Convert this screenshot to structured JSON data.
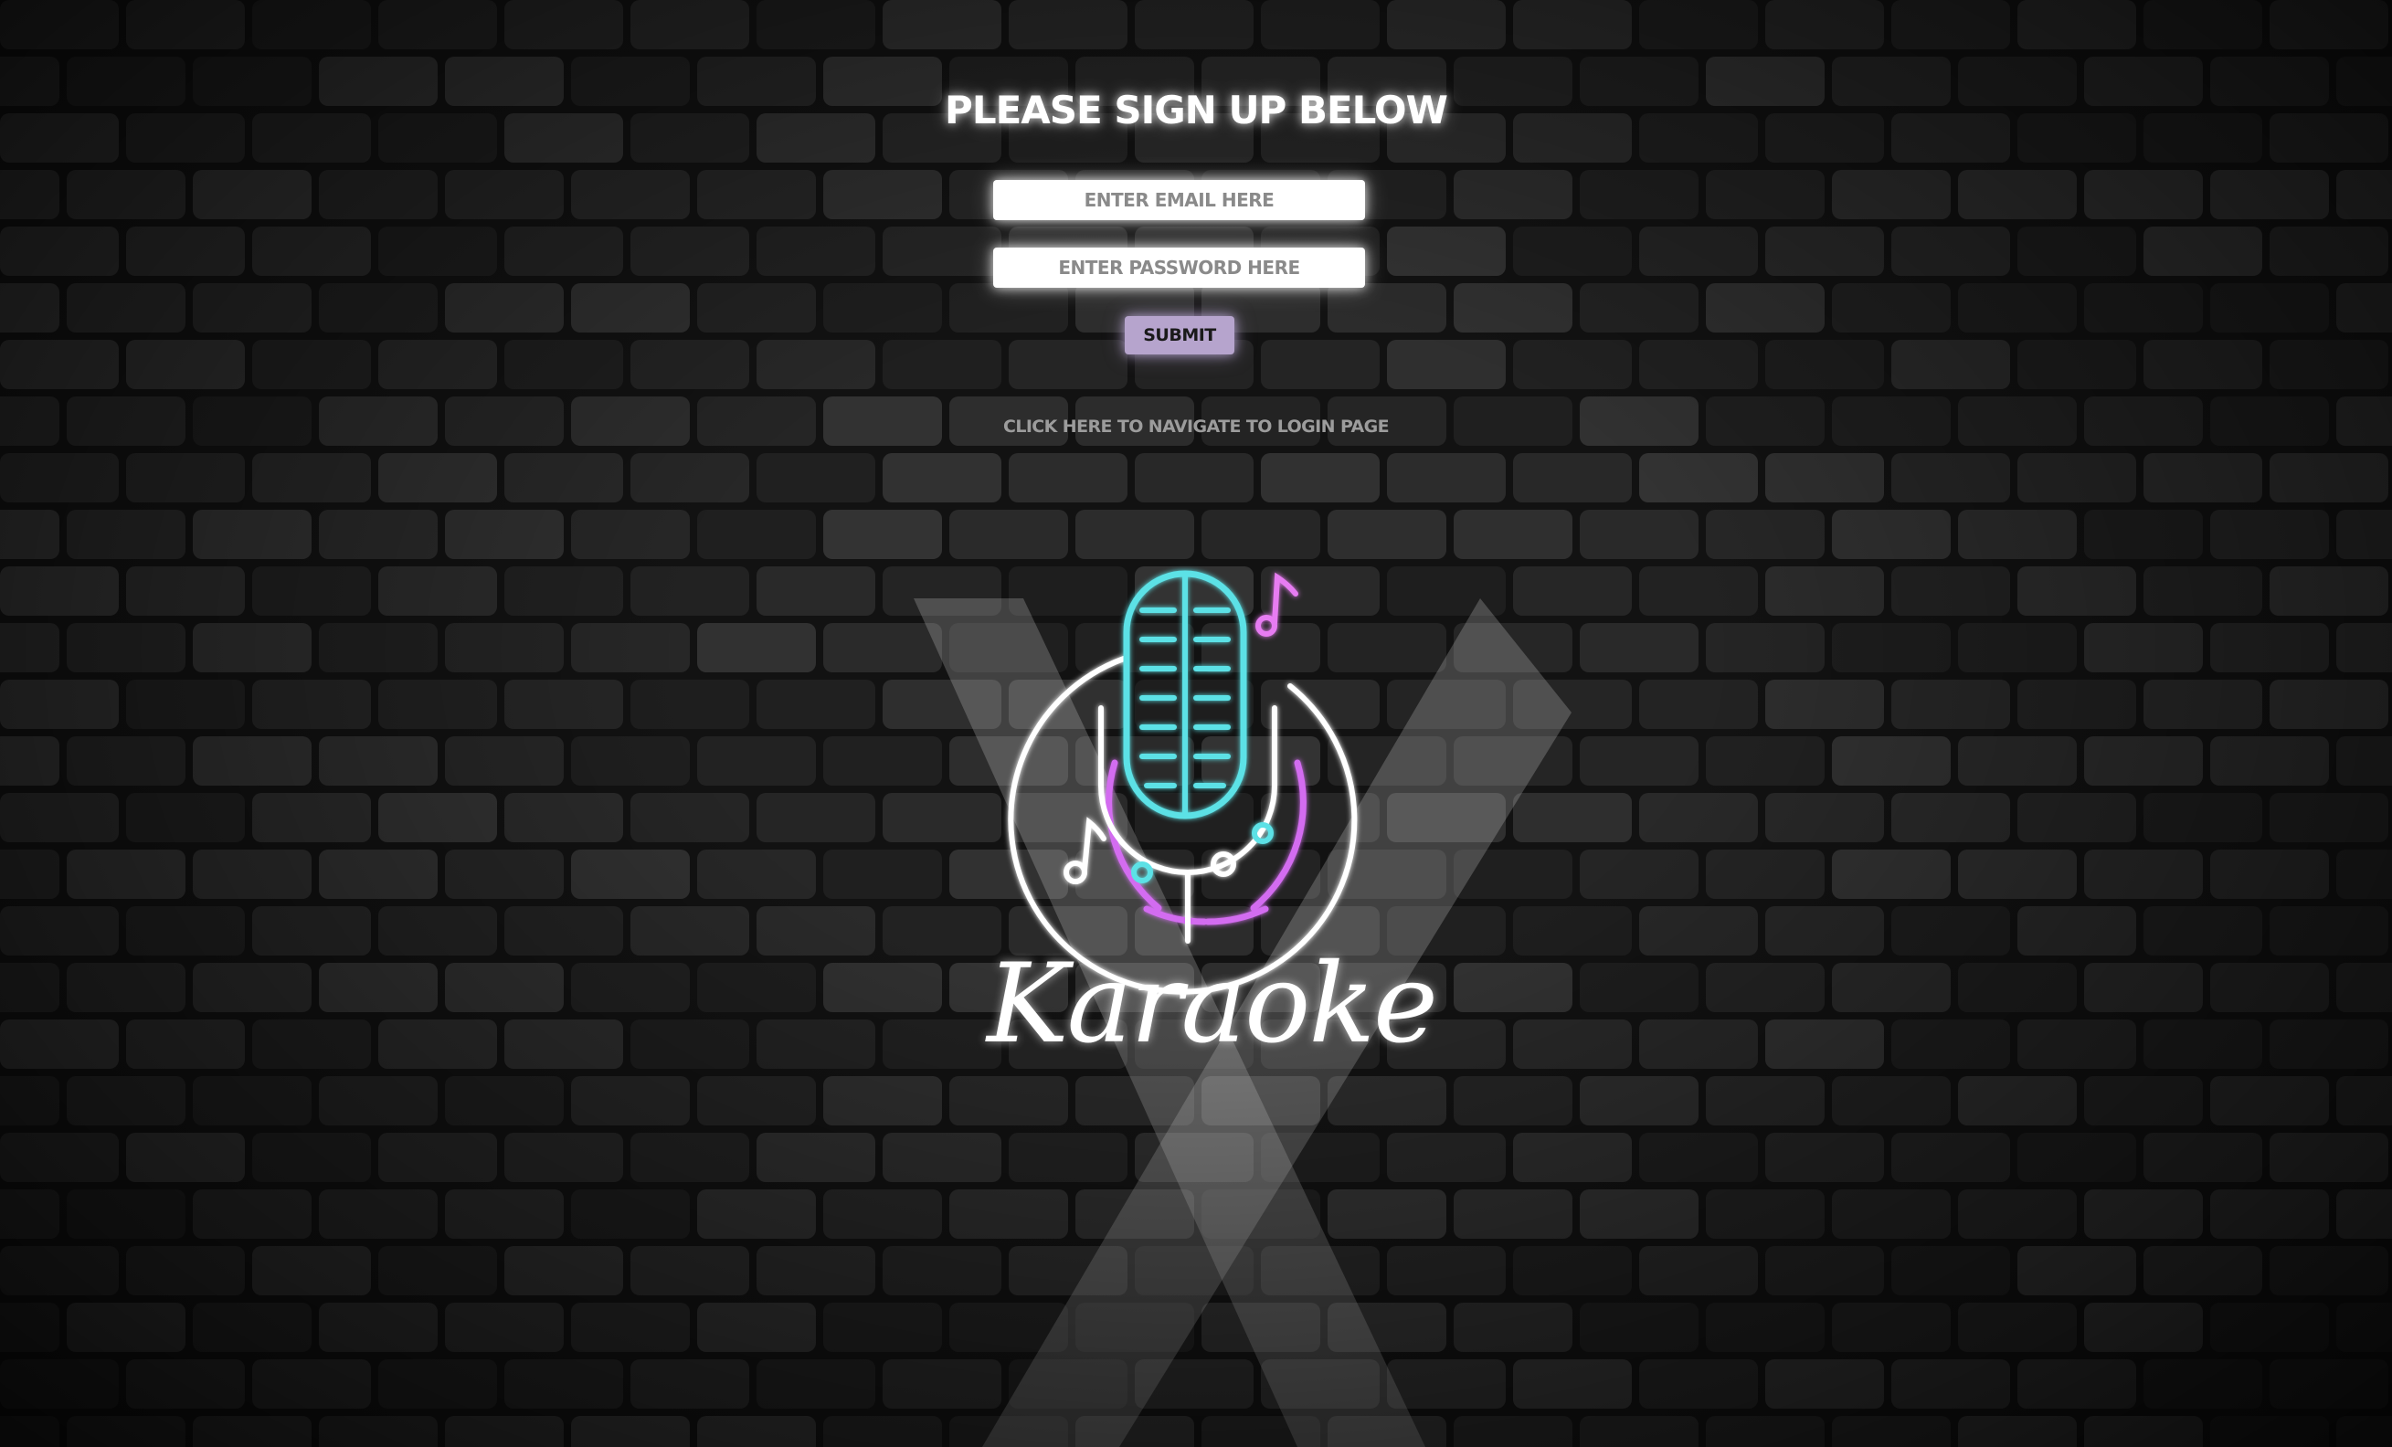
{
  "page": {
    "heading": "PLEASE SIGN UP BELOW",
    "email_placeholder": "ENTER EMAIL HERE",
    "password_placeholder": "ENTER PASSWORD HERE",
    "submit_label": "SUBMIT",
    "login_link": "CLICK HERE TO NAVIGATE TO LOGIN PAGE"
  },
  "logo": {
    "word": "Karaoke",
    "icon": "neon-microphone-icon",
    "colors": {
      "mic": "#5ce1e6",
      "arc": "#d36cf0",
      "ring": "#ffffff",
      "note_pink": "#e77cf2",
      "note_cyan": "#5ce1e6"
    }
  },
  "theme": {
    "background": "#161616",
    "brick": "#2a2a2a",
    "submit_bg": "#b6a4cd",
    "field_bg": "#ffffff",
    "link_color": "#9c9c9c"
  }
}
